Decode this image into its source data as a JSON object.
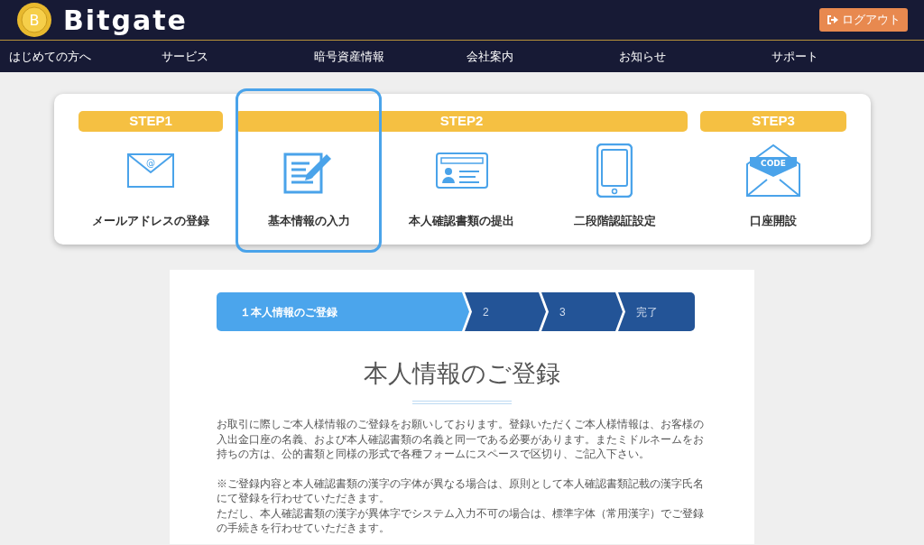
{
  "header": {
    "coin_letter": "B",
    "logo_text": "Bitgate",
    "logout_button": "ログアウト"
  },
  "nav": [
    "はじめての方へ",
    "サービス",
    "暗号資産情報",
    "会社案内",
    "お知らせ",
    "サポート"
  ],
  "step_groups": [
    {
      "label": "STEP1",
      "items": [
        {
          "kind": "mail",
          "icon_text": "@",
          "label": "メールアドレスの登録",
          "selected": false
        }
      ]
    },
    {
      "label": "STEP2",
      "items": [
        {
          "kind": "form",
          "label": "基本情報の入力",
          "selected": true
        },
        {
          "kind": "idcard",
          "label": "本人確認書類の提出",
          "selected": false
        },
        {
          "kind": "phone",
          "label": "二段階認証設定",
          "selected": false
        }
      ]
    },
    {
      "label": "STEP3",
      "items": [
        {
          "kind": "code",
          "icon_text": "CODE",
          "label": "口座開設",
          "selected": false
        }
      ]
    }
  ],
  "progress": [
    {
      "label": "１本人情報のご登録",
      "selected": true
    },
    {
      "label": "2",
      "selected": false
    },
    {
      "label": "3",
      "selected": false
    },
    {
      "label": "完了",
      "selected": false
    }
  ],
  "heading": "本人情報のご登録",
  "paragraphs": [
    [
      "お取引に際しご本人様情報のご登録をお願いしております。登録いただくご本人様情報は、お客様の入出金口座の名義、および本人確認書類の名義と同一である必要があります。またミドルネームをお持ちの方は、公的書類と同様の形式で各種フォームにスペースで区切り、ご記入下さい。"
    ],
    [
      "※ご登録内容と本人確認書類の漢字の字体が異なる場合は、原則として本人確認書類記載の漢字氏名にて登録を行わせていただきます。",
      "ただし、本人確認書類の漢字が異体字でシステム入力不可の場合は、標準字体（常用漢字）でご登録の手続きを行わせていただきます。"
    ]
  ]
}
